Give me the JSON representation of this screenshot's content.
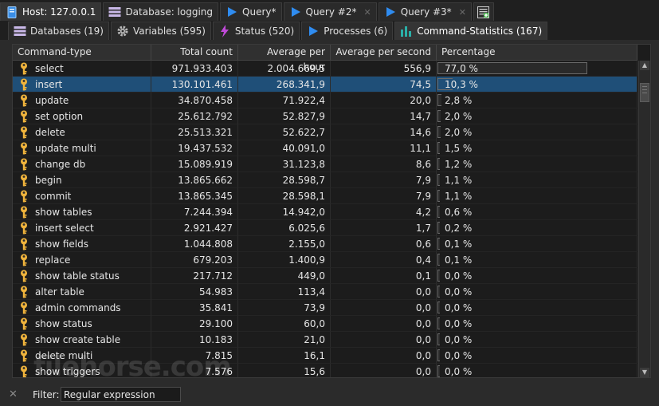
{
  "top_tabs": [
    {
      "label": "Host: 127.0.0.1",
      "icon": "server-icon"
    },
    {
      "label": "Database: logging",
      "icon": "database-icon"
    },
    {
      "label": "Query*",
      "icon": "play-icon"
    },
    {
      "label": "Query #2*",
      "icon": "play-icon"
    },
    {
      "label": "Query #3*",
      "icon": "play-icon"
    }
  ],
  "sub_tabs": [
    {
      "label": "Databases (19)",
      "icon": "databases-icon"
    },
    {
      "label": "Variables (595)",
      "icon": "gear-icon"
    },
    {
      "label": "Status (520)",
      "icon": "lightning-icon"
    },
    {
      "label": "Processes (6)",
      "icon": "play-icon"
    },
    {
      "label": "Command-Statistics (167)",
      "icon": "bar-chart-icon"
    }
  ],
  "columns": [
    "Command-type",
    "Total count",
    "Average per hour",
    "Average per second",
    "Percentage"
  ],
  "rows": [
    {
      "type": "select",
      "total": "971.933.403",
      "per_hour": "2.004.669,5",
      "per_sec": "556,9",
      "pct": "77,0 %",
      "pct_value": 77.0
    },
    {
      "type": "insert",
      "total": "130.101.461",
      "per_hour": "268.341,9",
      "per_sec": "74,5",
      "pct": "10,3 %",
      "pct_value": 10.3
    },
    {
      "type": "update",
      "total": "34.870.458",
      "per_hour": "71.922,4",
      "per_sec": "20,0",
      "pct": "2,8 %",
      "pct_value": 2.8
    },
    {
      "type": "set option",
      "total": "25.612.792",
      "per_hour": "52.827,9",
      "per_sec": "14,7",
      "pct": "2,0 %",
      "pct_value": 2.0
    },
    {
      "type": "delete",
      "total": "25.513.321",
      "per_hour": "52.622,7",
      "per_sec": "14,6",
      "pct": "2,0 %",
      "pct_value": 2.0
    },
    {
      "type": "update multi",
      "total": "19.437.532",
      "per_hour": "40.091,0",
      "per_sec": "11,1",
      "pct": "1,5 %",
      "pct_value": 1.5
    },
    {
      "type": "change db",
      "total": "15.089.919",
      "per_hour": "31.123,8",
      "per_sec": "8,6",
      "pct": "1,2 %",
      "pct_value": 1.2
    },
    {
      "type": "begin",
      "total": "13.865.662",
      "per_hour": "28.598,7",
      "per_sec": "7,9",
      "pct": "1,1 %",
      "pct_value": 1.1
    },
    {
      "type": "commit",
      "total": "13.865.345",
      "per_hour": "28.598,1",
      "per_sec": "7,9",
      "pct": "1,1 %",
      "pct_value": 1.1
    },
    {
      "type": "show tables",
      "total": "7.244.394",
      "per_hour": "14.942,0",
      "per_sec": "4,2",
      "pct": "0,6 %",
      "pct_value": 0.6
    },
    {
      "type": "insert select",
      "total": "2.921.427",
      "per_hour": "6.025,6",
      "per_sec": "1,7",
      "pct": "0,2 %",
      "pct_value": 0.2
    },
    {
      "type": "show fields",
      "total": "1.044.808",
      "per_hour": "2.155,0",
      "per_sec": "0,6",
      "pct": "0,1 %",
      "pct_value": 0.1
    },
    {
      "type": "replace",
      "total": "679.203",
      "per_hour": "1.400,9",
      "per_sec": "0,4",
      "pct": "0,1 %",
      "pct_value": 0.1
    },
    {
      "type": "show table status",
      "total": "217.712",
      "per_hour": "449,0",
      "per_sec": "0,1",
      "pct": "0,0 %",
      "pct_value": 0.0
    },
    {
      "type": "alter table",
      "total": "54.983",
      "per_hour": "113,4",
      "per_sec": "0,0",
      "pct": "0,0 %",
      "pct_value": 0.0
    },
    {
      "type": "admin commands",
      "total": "35.841",
      "per_hour": "73,9",
      "per_sec": "0,0",
      "pct": "0,0 %",
      "pct_value": 0.0
    },
    {
      "type": "show status",
      "total": "29.100",
      "per_hour": "60,0",
      "per_sec": "0,0",
      "pct": "0,0 %",
      "pct_value": 0.0
    },
    {
      "type": "show create table",
      "total": "10.183",
      "per_hour": "21,0",
      "per_sec": "0,0",
      "pct": "0,0 %",
      "pct_value": 0.0
    },
    {
      "type": "delete multi",
      "total": "7.815",
      "per_hour": "16,1",
      "per_sec": "0,0",
      "pct": "0,0 %",
      "pct_value": 0.0
    },
    {
      "type": "show triggers",
      "total": "7.576",
      "per_hour": "15,6",
      "per_sec": "0,0",
      "pct": "0,0 %",
      "pct_value": 0.0
    }
  ],
  "selected_row": 1,
  "filter": {
    "label": "Filter:",
    "value": "Regular expression"
  },
  "watermark": "filehorse.com",
  "colors": {
    "key_icon": "#f0b43c",
    "selection": "#1f4f78",
    "play_icon": "#2f8cf0",
    "lightning_icon": "#c04ad8",
    "chart_icon": "#2bb0a8"
  }
}
